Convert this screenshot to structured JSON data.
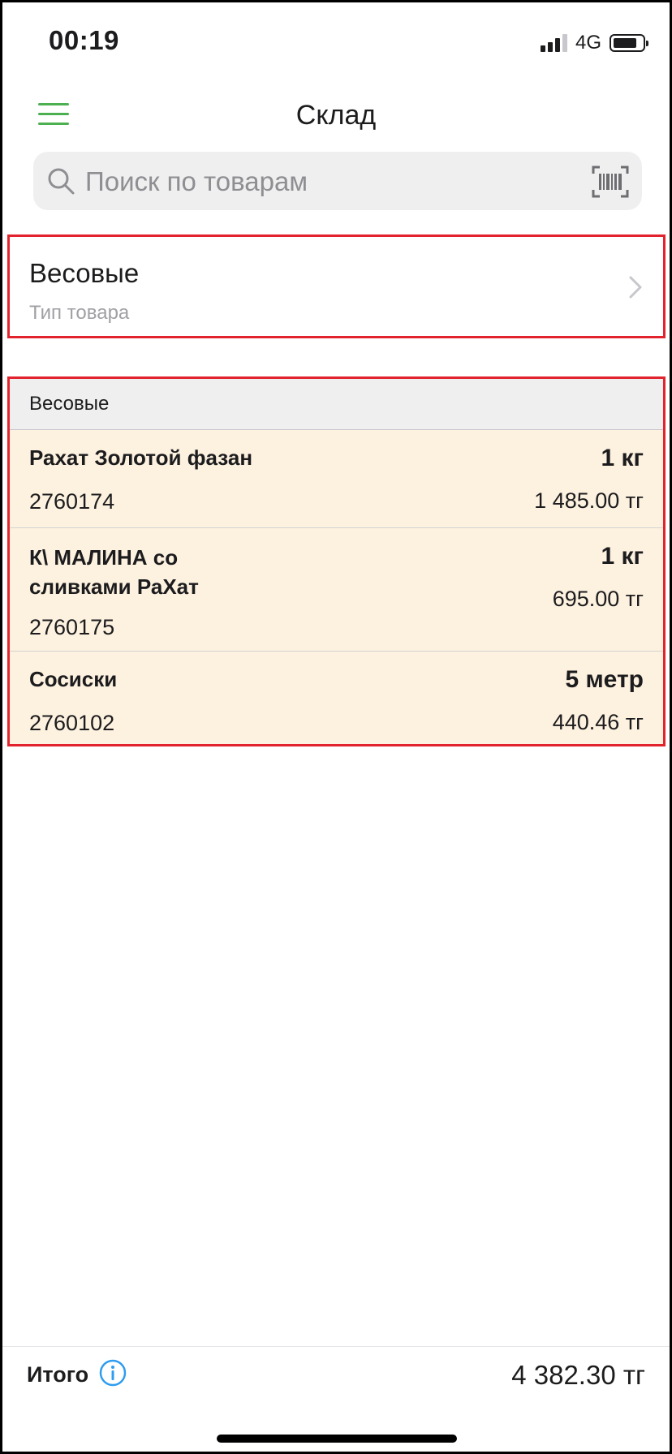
{
  "status_bar": {
    "time": "00:19",
    "network": "4G"
  },
  "header": {
    "title": "Склад",
    "menu_icon": "hamburger-menu-icon"
  },
  "search": {
    "placeholder": "Поиск по товарам",
    "value": "",
    "left_icon": "search-icon",
    "right_icon": "barcode-scan-icon"
  },
  "filter": {
    "title": "Весовые",
    "subtitle": "Тип товара"
  },
  "section": {
    "header": "Весовые",
    "items": [
      {
        "name": "Рахат Золотой фазан",
        "code": "2760174",
        "quantity": "1 кг",
        "price": "1 485.00 тг"
      },
      {
        "name": "К\\ МАЛИНА со сливками РаХат",
        "code": "2760175",
        "quantity": "1 кг",
        "price": "695.00 тг"
      },
      {
        "name": "Сосиски",
        "code": "2760102",
        "quantity": "5 метр",
        "price": "440.46 тг"
      }
    ]
  },
  "footer": {
    "total_label": "Итого",
    "total_value": "4 382.30 тг"
  },
  "colors": {
    "accent_green": "#4caf50",
    "highlight_red": "#e2232d",
    "item_background": "#fdf1df",
    "info_blue": "#2f9cf0"
  }
}
